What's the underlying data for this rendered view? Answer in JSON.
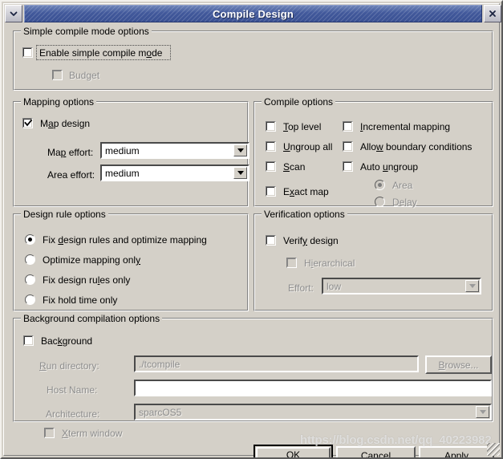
{
  "window": {
    "title": "Compile Design",
    "menu_icon": "chevron-down-icon",
    "close_icon": "close-icon"
  },
  "simple_compile": {
    "group_title": "Simple compile mode options",
    "enable": {
      "label": "Enable simple compile mode",
      "checked": false,
      "enabled": true,
      "focused": true
    },
    "budget": {
      "label": "Budget",
      "checked": false,
      "enabled": false
    }
  },
  "mapping": {
    "group_title": "Mapping options",
    "map_design": {
      "label": "Map design",
      "checked": true,
      "enabled": true
    },
    "map_effort": {
      "label": "Map effort:",
      "value": "medium",
      "enabled": true
    },
    "area_effort": {
      "label": "Area effort:",
      "value": "medium",
      "enabled": true
    }
  },
  "compile": {
    "group_title": "Compile options",
    "top_level": {
      "label": "Top level",
      "checked": false,
      "enabled": true
    },
    "ungroup_all": {
      "label": "Ungroup all",
      "checked": false,
      "enabled": true
    },
    "scan": {
      "label": "Scan",
      "checked": false,
      "enabled": true
    },
    "exact_map": {
      "label": "Exact map",
      "checked": false,
      "enabled": true
    },
    "incremental_mapping": {
      "label": "Incremental mapping",
      "checked": false,
      "enabled": true
    },
    "allow_boundary": {
      "label": "Allow boundary conditions",
      "checked": false,
      "enabled": true
    },
    "auto_ungroup": {
      "label": "Auto ungroup",
      "checked": false,
      "enabled": true
    },
    "ungroup_mode": {
      "selected": "Area",
      "enabled": false,
      "options": [
        {
          "label": "Area",
          "selected": true
        },
        {
          "label": "Delay",
          "selected": false
        }
      ]
    }
  },
  "design_rule": {
    "group_title": "Design rule options",
    "selected": "Fix design rules and  optimize mapping",
    "options": [
      {
        "label": "Fix design rules and  optimize mapping",
        "selected": true
      },
      {
        "label": "Optimize mapping only",
        "selected": false
      },
      {
        "label": "Fix design rules only",
        "selected": false
      },
      {
        "label": "Fix hold time only",
        "selected": false
      }
    ]
  },
  "verification": {
    "group_title": "Verification options",
    "verify_design": {
      "label": "Verify design",
      "checked": false,
      "enabled": true
    },
    "hierarchical": {
      "label": "Hierarchical",
      "checked": false,
      "enabled": false
    },
    "effort": {
      "label": "Effort:",
      "value": "low",
      "enabled": false
    }
  },
  "background": {
    "group_title": "Background compilation options",
    "background": {
      "label": "Background",
      "checked": false,
      "enabled": true
    },
    "run_directory": {
      "label": "Run directory:",
      "value": "./tcompile",
      "enabled": false
    },
    "browse": {
      "label": "Browse...",
      "enabled": false
    },
    "host_name": {
      "label": "Host Name:",
      "value": "",
      "enabled": false
    },
    "architecture": {
      "label": "Architecture:",
      "value": "sparcOS5",
      "enabled": false
    },
    "xterm_window": {
      "label": "Xterm window",
      "checked": false,
      "enabled": false
    }
  },
  "buttons": {
    "ok": "OK",
    "cancel": "Cancel",
    "apply": "Apply"
  },
  "watermark": "https://blog.csdn.net/qq_40223982"
}
